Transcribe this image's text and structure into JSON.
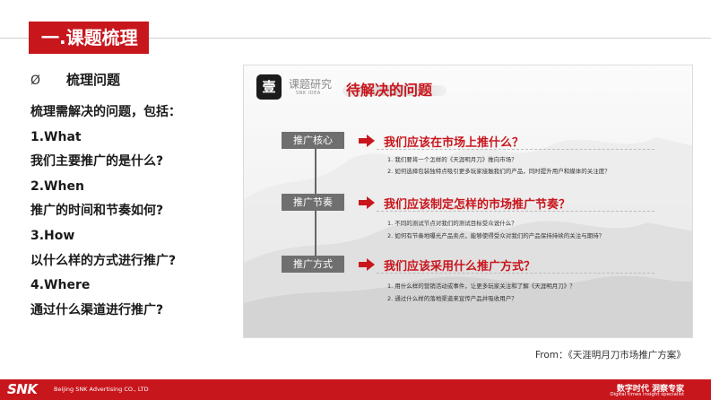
{
  "header": {
    "title": "一.课题梳理"
  },
  "left": {
    "bullet": "Ø",
    "subhead": "梳理问题",
    "lines": [
      "梳理需解决的问题，包括：",
      "1.What",
      "我们主要推广的是什么?",
      "2.When",
      "推广的时间和节奏如何?",
      "3.How",
      "以什么样的方式进行推广?",
      "4.Where",
      "通过什么渠道进行推广?"
    ]
  },
  "panel": {
    "seal_char": "壹",
    "seal_title": "课题研究",
    "seal_sub": "SNK IDEA",
    "title": "待解决的问题",
    "sections": [
      {
        "label": "推广核心",
        "question": "我们应该在市场上推什么？",
        "items": [
          "1.  我们要将一个怎样的《天涯明月刀》推向市场？",
          "2.  如何选择包装独特点吸引更多玩家接触我们的产品，同时提升用户和媒体的关注度？"
        ]
      },
      {
        "label": "推广节奏",
        "question": "我们应该制定怎样的市场推广节奏？",
        "items": [
          "1.  不同的测试节点对我们的测试目标受众说什么？",
          "2.  如何有节奏地曝光产品卖点，能够使得受众对我们的产品保持持续的关注与期待？"
        ]
      },
      {
        "label": "推广方式",
        "question": "我们应该采用什么推广方式？",
        "items": [
          "1.  用什么样的营销活动或事件，让更多玩家关注和了解《天涯明月刀》？",
          "2.  通过什么样的落地渠道来宣传产品并吸收用户？"
        ]
      }
    ]
  },
  "source": "From：《天涯明月刀市场推广方案》",
  "footer": {
    "logo": "SNK",
    "company": "Beijing SNK Advertising CO., LTD",
    "slogan": "数字时代 洞察专家",
    "slogan_en": "Digital times insight specialist"
  },
  "colors": {
    "accent": "#c8161d",
    "label_bg": "#6f6f6f"
  }
}
